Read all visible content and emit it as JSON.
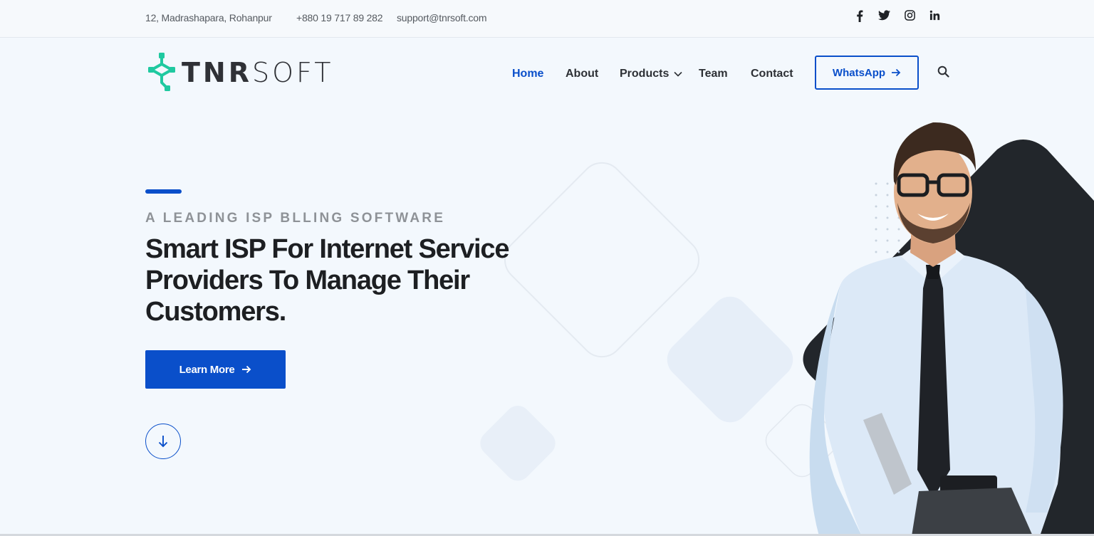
{
  "topbar": {
    "address": "12, Madrashapara, Rohanpur",
    "phone": "+880 19 717 89 282",
    "email": "support@tnrsoft.com",
    "social": [
      {
        "icon": "facebook-icon",
        "label": "f"
      },
      {
        "icon": "twitter-icon",
        "label": ""
      },
      {
        "icon": "instagram-icon",
        "label": ""
      },
      {
        "icon": "linkedin-icon",
        "label": "in"
      }
    ]
  },
  "brand": {
    "name_bold": "TNR",
    "name_light": "SOFT",
    "logo_color": "#1fc9a0"
  },
  "nav": {
    "items": [
      "Home",
      "About",
      "Products",
      "Team",
      "Contact"
    ],
    "active": "Home",
    "whatsapp_label": "WhatsApp"
  },
  "hero": {
    "kicker": "A LEADING ISP BLLING SOFTWARE",
    "headline": "Smart ISP For Internet Service Providers To Manage Their Customers.",
    "cta_label": "Learn More"
  },
  "colors": {
    "accent": "#0a4fca",
    "background": "#f3f8fd",
    "dark_shape": "#22262b"
  }
}
